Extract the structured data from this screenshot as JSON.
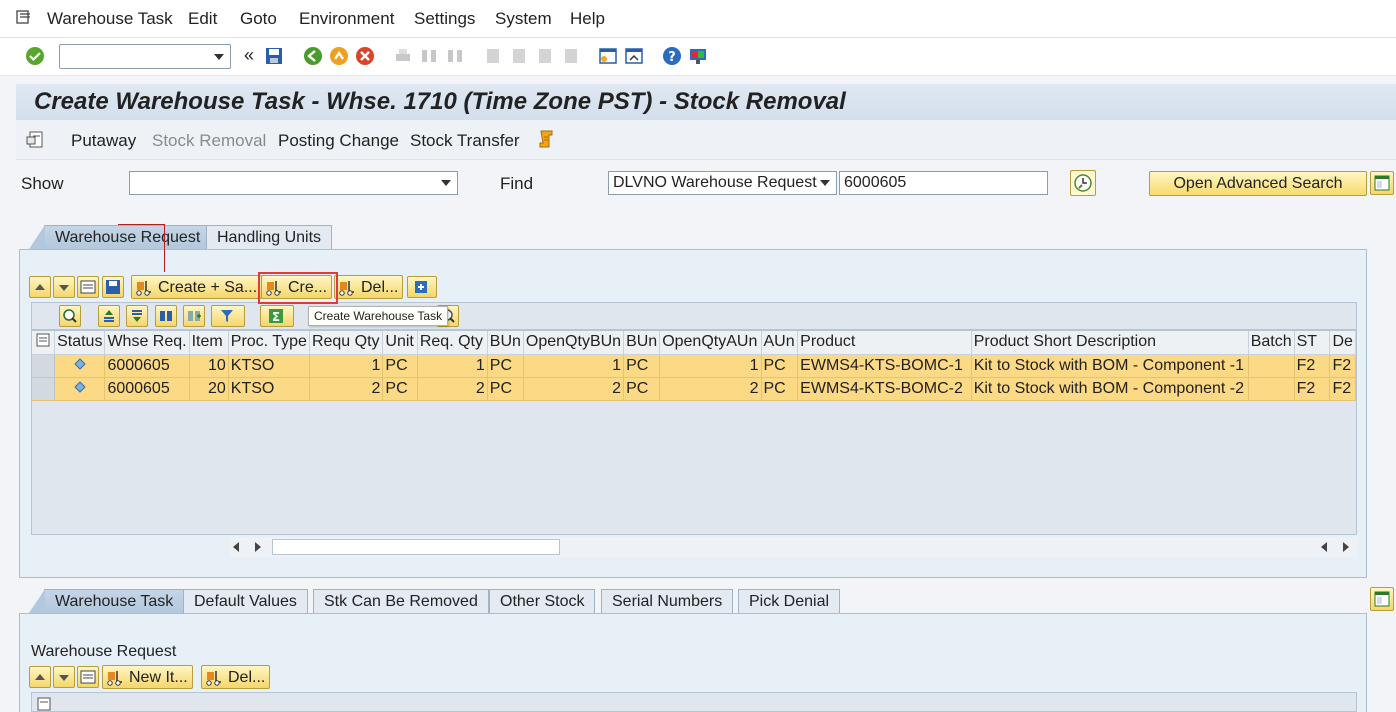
{
  "menu": [
    "Warehouse Task",
    "Edit",
    "Goto",
    "Environment",
    "Settings",
    "System",
    "Help"
  ],
  "title": "Create Warehouse Task - Whse. 1710 (Time Zone PST) - Stock Removal",
  "app_toolbar": {
    "putaway": "Putaway",
    "stock_removal": "Stock Removal",
    "posting_change": "Posting Change",
    "stock_transfer": "Stock Transfer"
  },
  "search": {
    "show_label": "Show",
    "show_value": "",
    "find_label": "Find",
    "find_type": "DLVNO Warehouse Request",
    "find_value": "6000605",
    "advanced_label": "Open Advanced Search"
  },
  "upper_tabs": [
    "Warehouse Request",
    "Handling Units"
  ],
  "alv_buttons": {
    "create_save": "Create + Sa...",
    "create": "Cre...",
    "delete": "Del..."
  },
  "tooltip": "Create Warehouse Task",
  "table": {
    "columns": [
      "Status",
      "Whse Req.",
      "Item",
      "Proc. Type",
      "Requ Qty",
      "Unit",
      "Req. Qty",
      "BUn",
      "OpenQtyBUn",
      "BUn",
      "OpenQtyAUn",
      "AUn",
      "Product",
      "Product Short Description",
      "Batch",
      "ST",
      "De"
    ],
    "rows": [
      [
        "6000605",
        "10",
        "KTSO",
        "1",
        "PC",
        "1",
        "PC",
        "1",
        "PC",
        "1",
        "PC",
        "EWMS4-KTS-BOMC-1",
        "Kit to Stock with BOM - Component -1",
        "",
        "F2",
        "F2"
      ],
      [
        "6000605",
        "20",
        "KTSO",
        "2",
        "PC",
        "2",
        "PC",
        "2",
        "PC",
        "2",
        "PC",
        "EWMS4-KTS-BOMC-2",
        "Kit to Stock with BOM - Component -2",
        "",
        "F2",
        "F2"
      ]
    ]
  },
  "lower_tabs": [
    "Warehouse Task",
    "Default Values",
    "Stk Can Be Removed",
    "Other Stock",
    "Serial Numbers",
    "Pick Denial"
  ],
  "lower": {
    "section_label": "Warehouse Request",
    "new_item": "New It...",
    "delete": "Del..."
  },
  "colors": {
    "row_highlight": "#fbd985",
    "title_bg": "#d4dfec",
    "button_yellow": "#f5d66a",
    "annotation_red": "#e03a3a"
  }
}
